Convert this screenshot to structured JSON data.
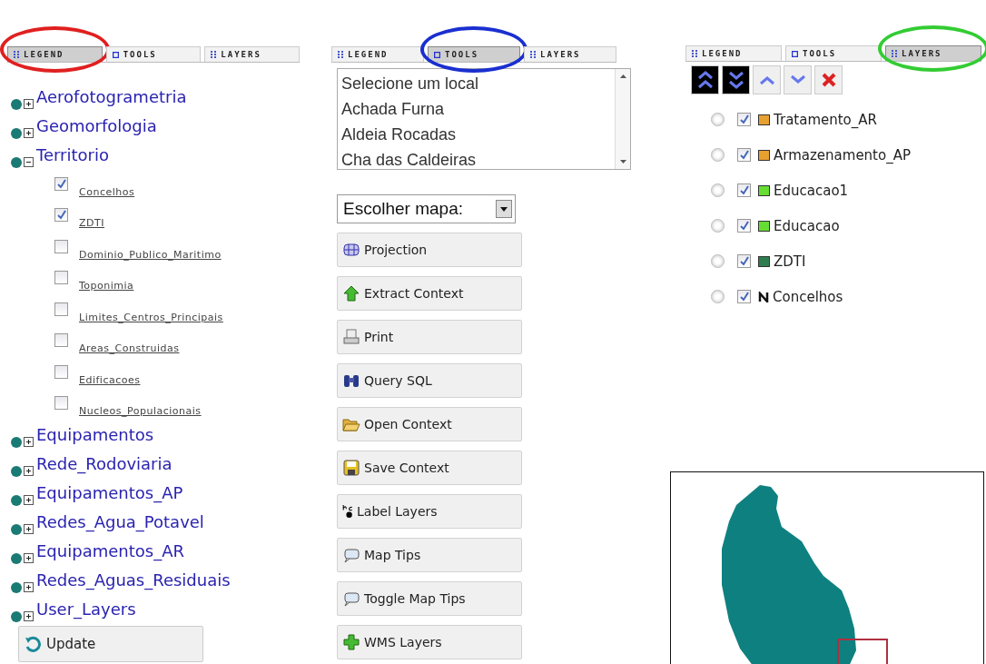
{
  "panels": [
    {
      "color": "#e02020",
      "tabs": [
        {
          "kind": "legend",
          "label": "LEGEND",
          "selected": true
        },
        {
          "kind": "tools",
          "label": "TOOLS",
          "selected": false
        },
        {
          "kind": "layers",
          "label": "LAYERS",
          "selected": false
        }
      ]
    },
    {
      "color": "#1a2fd0",
      "tabs": [
        {
          "kind": "legend",
          "label": "LEGEND",
          "selected": false
        },
        {
          "kind": "tools",
          "label": "TOOLS",
          "selected": true
        },
        {
          "kind": "layers",
          "label": "LAYERS",
          "selected": false
        }
      ]
    },
    {
      "color": "#33cc33",
      "tabs": [
        {
          "kind": "legend",
          "label": "LEGEND",
          "selected": false
        },
        {
          "kind": "tools",
          "label": "TOOLS",
          "selected": false
        },
        {
          "kind": "layers",
          "label": "LAYERS",
          "selected": true
        }
      ]
    }
  ],
  "legend": {
    "groups": [
      {
        "label": "Aerofotogrametria",
        "expanded": false
      },
      {
        "label": "Geomorfologia",
        "expanded": false
      },
      {
        "label": "Territorio",
        "expanded": true,
        "children": [
          {
            "label": "Concelhos",
            "checked": true
          },
          {
            "label": "ZDTI",
            "checked": true
          },
          {
            "label": "Dominio_Publico_Maritimo",
            "checked": false
          },
          {
            "label": "Toponimia",
            "checked": false
          },
          {
            "label": "Limites_Centros_Principais",
            "checked": false
          },
          {
            "label": "Areas_Construidas",
            "checked": false
          },
          {
            "label": "Edificacoes",
            "checked": false
          },
          {
            "label": "Nucleos_Populacionais",
            "checked": false
          }
        ]
      },
      {
        "label": "Equipamentos",
        "expanded": false
      },
      {
        "label": "Rede_Rodoviaria",
        "expanded": false
      },
      {
        "label": "Equipamentos_AP",
        "expanded": false
      },
      {
        "label": "Redes_Agua_Potavel",
        "expanded": false
      },
      {
        "label": "Equipamentos_AR",
        "expanded": false
      },
      {
        "label": "Redes_Aguas_Residuais",
        "expanded": false
      },
      {
        "label": "User_Layers",
        "expanded": false
      }
    ],
    "update_button": "Update"
  },
  "tools": {
    "locations": [
      "Selecione um local",
      "Achada Furna",
      "Aldeia Rocadas",
      "Cha das Caldeiras"
    ],
    "map_select": "Escolher mapa:",
    "buttons": [
      {
        "kind": "projection",
        "label": "Projection"
      },
      {
        "kind": "extract",
        "label": "Extract Context"
      },
      {
        "kind": "print",
        "label": "Print"
      },
      {
        "kind": "query",
        "label": "Query SQL"
      },
      {
        "kind": "open",
        "label": "Open Context"
      },
      {
        "kind": "save",
        "label": "Save Context"
      },
      {
        "kind": "label",
        "label": "Label Layers"
      },
      {
        "kind": "tips",
        "label": "Map Tips"
      },
      {
        "kind": "tips",
        "label": "Toggle Map Tips"
      },
      {
        "kind": "wms",
        "label": "WMS Layers"
      }
    ]
  },
  "layers": {
    "toolbar": [
      {
        "kind": "top"
      },
      {
        "kind": "bottom"
      },
      {
        "kind": "up"
      },
      {
        "kind": "down"
      },
      {
        "kind": "remove"
      }
    ],
    "items": [
      {
        "label": "Tratamento_AR",
        "kind": "fill",
        "color": "#e8a030",
        "checked": true,
        "selected": false
      },
      {
        "label": "Armazenamento_AP",
        "kind": "fill",
        "color": "#e8a030",
        "checked": true,
        "selected": false
      },
      {
        "label": "Educacao1",
        "kind": "fill",
        "color": "#66dd33",
        "checked": true,
        "selected": false
      },
      {
        "label": "Educacao",
        "kind": "fill",
        "color": "#66dd33",
        "checked": true,
        "selected": false
      },
      {
        "label": "ZDTI",
        "kind": "fill",
        "color": "#2e7d4f",
        "checked": true,
        "selected": false
      },
      {
        "label": "Concelhos",
        "kind": "line",
        "color": "#111111",
        "checked": true,
        "selected": false
      }
    ]
  }
}
